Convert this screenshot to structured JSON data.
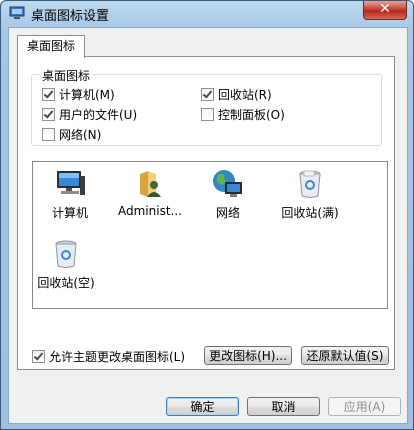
{
  "window": {
    "title": "桌面图标设置",
    "close_glyph": "✕"
  },
  "tab": {
    "label": "桌面图标"
  },
  "group": {
    "legend": "桌面图标",
    "checkboxes": [
      {
        "label": "计算机(M)",
        "checked": true
      },
      {
        "label": "回收站(R)",
        "checked": true
      },
      {
        "label": "用户的文件(U)",
        "checked": true
      },
      {
        "label": "控制面板(O)",
        "checked": false
      },
      {
        "label": "网络(N)",
        "checked": false
      }
    ]
  },
  "icons": [
    {
      "label": "计算机",
      "icon": "computer-icon"
    },
    {
      "label": "Administ...",
      "icon": "user-folder-icon"
    },
    {
      "label": "网络",
      "icon": "network-globe-icon"
    },
    {
      "label": "回收站(满)",
      "icon": "recycle-bin-full-icon"
    },
    {
      "label": "回收站(空)",
      "icon": "recycle-bin-empty-icon"
    }
  ],
  "buttons": {
    "change_icon": "更改图标(H)...",
    "restore_default": "还原默认值(S)",
    "ok": "确定",
    "cancel": "取消",
    "apply": "应用(A)"
  },
  "theme_checkbox": {
    "label": "允许主题更改桌面图标(L)",
    "checked": true
  }
}
